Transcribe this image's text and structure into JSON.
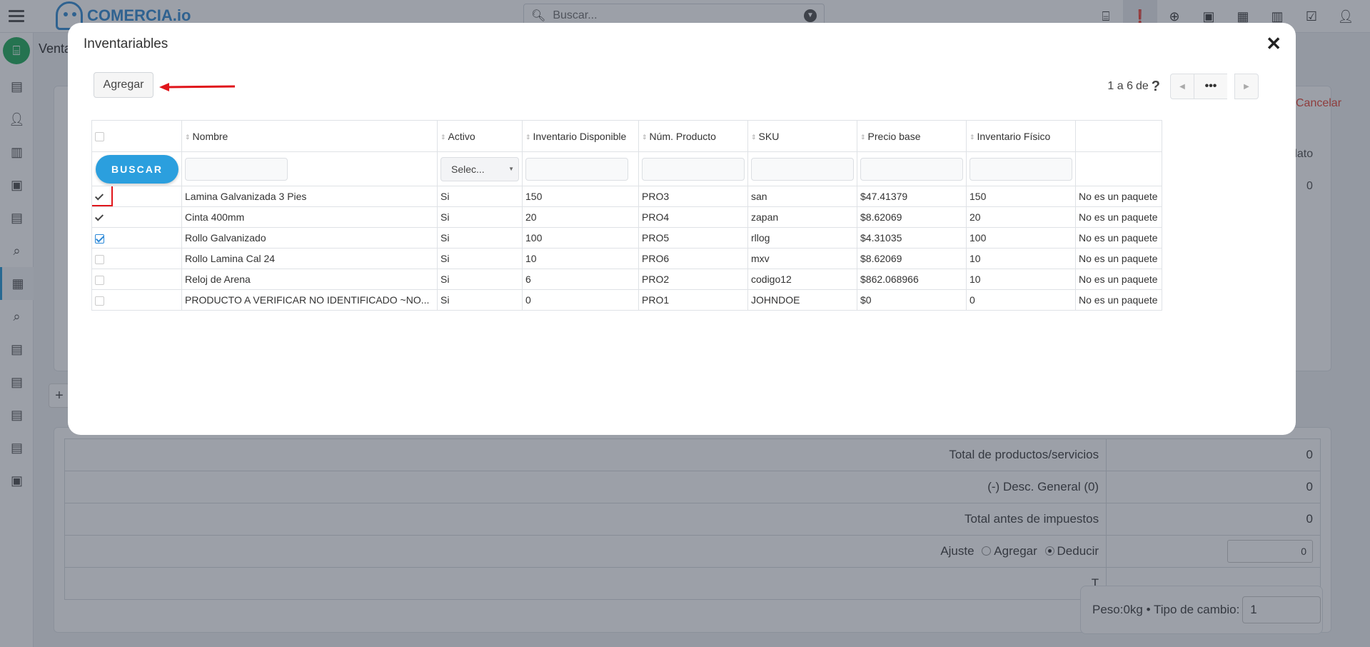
{
  "app": {
    "logo_text": "COMERCIA.io",
    "section_title": "Venta",
    "search_placeholder": "Buscar...",
    "cancel_label": "Cancelar",
    "dato_label": "dato",
    "dato_value": "0",
    "add_icon_label": "+"
  },
  "totals": {
    "rows": [
      {
        "label": "Total de productos/servicios",
        "value": "0"
      },
      {
        "label": "(-) Desc. General (0)",
        "value": "0"
      },
      {
        "label": "Total antes de impuestos",
        "value": "0"
      }
    ],
    "ajuste_label": "Ajuste",
    "agregar_option": "Agregar",
    "deducir_option": "Deducir",
    "ajuste_value": "0",
    "last_row_label": "T"
  },
  "footer": {
    "peso_text": "Peso:0kg • Tipo de cambio:",
    "tipo_cambio_value": "1"
  },
  "modal": {
    "title": "Inventariables",
    "close_glyph": "✕",
    "add_button": "Agregar",
    "pager": {
      "range_text": "1 a 6",
      "of_text": "de",
      "unknown_total": "?",
      "more_glyph": "•••"
    },
    "search_button": "BUSCAR",
    "activo_filter_value": "Selec...",
    "columns": [
      "Nombre",
      "Activo",
      "Inventario Disponible",
      "Núm. Producto",
      "SKU",
      "Precio base",
      "Inventario Físico"
    ],
    "rows": [
      {
        "nombre": "Lamina Galvanizada 3 Pies",
        "activo": "Si",
        "disponible": "150",
        "num": "PRO3",
        "sku": "san",
        "precio": "$47.41379",
        "fisico": "150",
        "paquete": "No es un paquete",
        "check": "tick"
      },
      {
        "nombre": "Cinta 400mm",
        "activo": "Si",
        "disponible": "20",
        "num": "PRO4",
        "sku": "zapan",
        "precio": "$8.62069",
        "fisico": "20",
        "paquete": "No es un paquete",
        "check": "tick"
      },
      {
        "nombre": "Rollo Galvanizado",
        "activo": "Si",
        "disponible": "100",
        "num": "PRO5",
        "sku": "rllog",
        "precio": "$4.31035",
        "fisico": "100",
        "paquete": "No es un paquete",
        "check": "checked"
      },
      {
        "nombre": "Rollo Lamina Cal 24",
        "activo": "Si",
        "disponible": "10",
        "num": "PRO6",
        "sku": "mxv",
        "precio": "$8.62069",
        "fisico": "10",
        "paquete": "No es un paquete",
        "check": "none"
      },
      {
        "nombre": "Reloj de Arena",
        "activo": "Si",
        "disponible": "6",
        "num": "PRO2",
        "sku": "codigo12",
        "precio": "$862.068966",
        "fisico": "10",
        "paquete": "No es un paquete",
        "check": "none"
      },
      {
        "nombre": "PRODUCTO A VERIFICAR NO IDENTIFICADO ~NO...",
        "activo": "Si",
        "disponible": "0",
        "num": "PRO1",
        "sku": "JOHNDOE",
        "precio": "$0",
        "fisico": "0",
        "paquete": "No es un paquete",
        "check": "none"
      }
    ]
  },
  "colors": {
    "accent": "#2b9fde",
    "annotation": "#e0151b",
    "home_icon": "#27ae60",
    "cancel": "#e74c3c"
  }
}
